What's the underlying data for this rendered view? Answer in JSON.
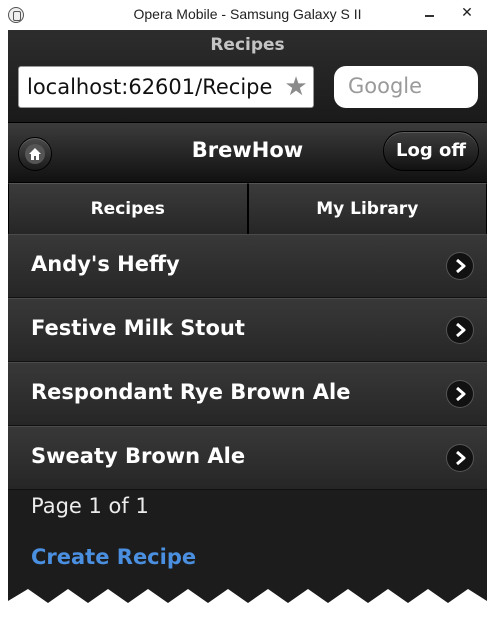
{
  "window": {
    "title": "Opera Mobile - Samsung Galaxy S II",
    "close_glyph": "✕"
  },
  "browser": {
    "page_title": "Recipes",
    "url": "localhost:62601/Recipe",
    "search_placeholder": "Google"
  },
  "header": {
    "title": "BrewHow",
    "logoff_label": "Log off"
  },
  "navbar": {
    "items": [
      {
        "label": "Recipes"
      },
      {
        "label": "My Library"
      }
    ]
  },
  "recipes": {
    "items": [
      {
        "name": "Andy's Heffy"
      },
      {
        "name": "Festive Milk Stout"
      },
      {
        "name": "Respondant Rye Brown Ale"
      },
      {
        "name": "Sweaty Brown Ale"
      }
    ]
  },
  "pagination": {
    "text": "Page 1 of 1"
  },
  "actions": {
    "create_label": "Create Recipe"
  },
  "colors": {
    "link": "#4a8fe0",
    "background": "#1c1c1c"
  },
  "icons": {
    "home": "home-icon",
    "star": "star-icon",
    "arrow": "chevron-right-icon"
  }
}
